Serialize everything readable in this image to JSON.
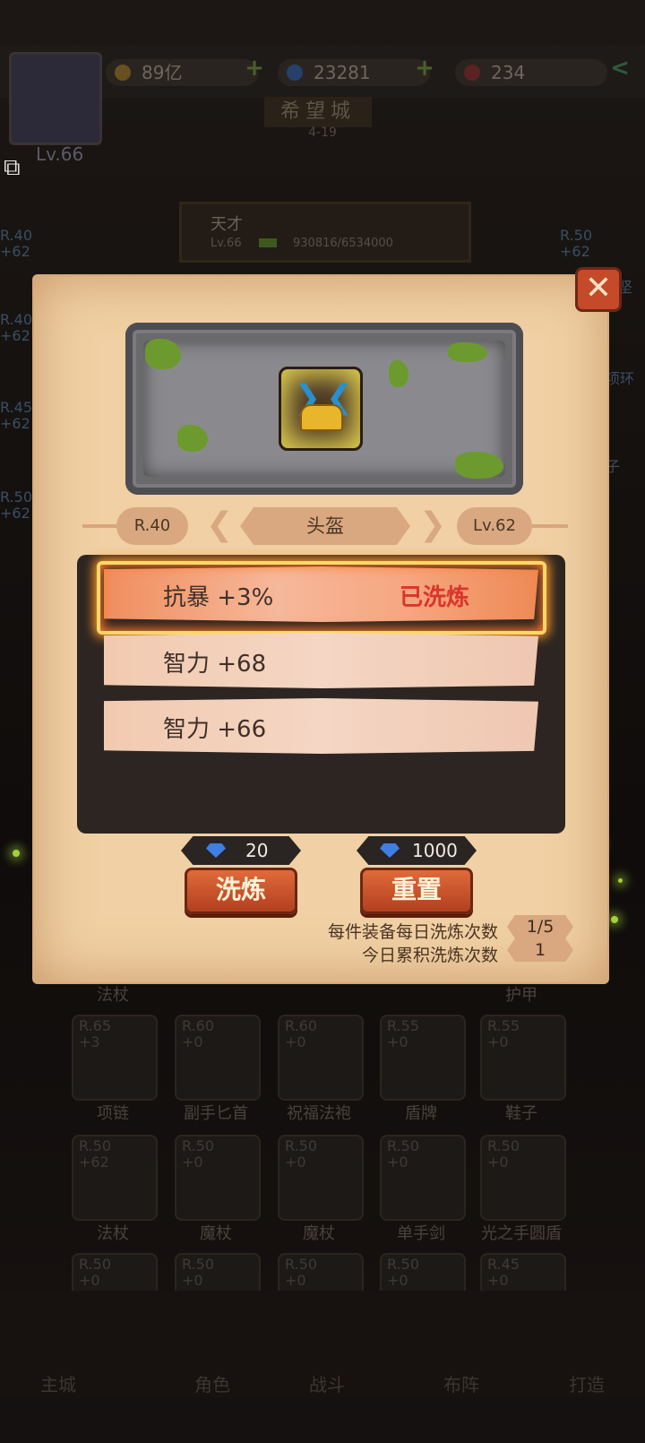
{
  "resources": {
    "gold": "89亿",
    "gems": "23281",
    "crystals": "234"
  },
  "player": {
    "level": "Lv.66",
    "name": "天才",
    "level_short": "Lv.66",
    "exp": "930816/6534000"
  },
  "city": {
    "name": "希望城",
    "sub": "4-19"
  },
  "bg_left": [
    "R.40\n+62",
    "R.40\n+62",
    "R.45\n+62",
    "R.50\n+62"
  ],
  "bg_right": [
    "R.50\n+62",
    "坚",
    "项环",
    "子"
  ],
  "bg_slots": [
    {
      "rank": "R.65",
      "plus": "+3",
      "label": "项链"
    },
    {
      "rank": "R.60",
      "plus": "+0",
      "label": "副手匕首"
    },
    {
      "rank": "R.60",
      "plus": "+0",
      "label": "祝福法袍"
    },
    {
      "rank": "R.55",
      "plus": "+0",
      "label": "盾牌"
    },
    {
      "rank": "R.55",
      "plus": "+0",
      "label": "鞋子"
    },
    {
      "rank": "R.50",
      "plus": "+62",
      "label": "法杖"
    },
    {
      "rank": "R.50",
      "plus": "+0",
      "label": "魔杖"
    },
    {
      "rank": "R.50",
      "plus": "+0",
      "label": "魔杖"
    },
    {
      "rank": "R.50",
      "plus": "+0",
      "label": "单手剑"
    },
    {
      "rank": "R.50",
      "plus": "+0",
      "label": "光之手圆盾"
    },
    {
      "rank": "R.50",
      "plus": "+0",
      "label": ""
    },
    {
      "rank": "R.50",
      "plus": "+0",
      "label": ""
    },
    {
      "rank": "R.50",
      "plus": "+0",
      "label": ""
    },
    {
      "rank": "R.50",
      "plus": "+0",
      "label": ""
    },
    {
      "rank": "R.45",
      "plus": "+0",
      "label": ""
    }
  ],
  "bg_headers": {
    "left": "法杖",
    "right": "护甲"
  },
  "nav": [
    "主城",
    "角色",
    "战斗",
    "布阵",
    "打造"
  ],
  "modal": {
    "close": "✕",
    "rank": "R.40",
    "item_name": "头盔",
    "item_level": "Lv.62",
    "stats": [
      {
        "text": "抗暴 +3%",
        "status": "已洗炼",
        "selected": true
      },
      {
        "text": "智力 +68",
        "status": "",
        "selected": false
      },
      {
        "text": "智力 +66",
        "status": "",
        "selected": false
      }
    ],
    "refine": {
      "cost": "20",
      "label": "洗炼"
    },
    "reset": {
      "cost": "1000",
      "label": "重置"
    },
    "counts": [
      {
        "label": "每件装备每日洗炼次数",
        "value": "1/5"
      },
      {
        "label": "今日累积洗炼次数",
        "value": "1"
      }
    ]
  },
  "colors": {
    "parchment": "#f0d0a4",
    "button": "#c44a2a",
    "washed_text": "#d8362d",
    "gem": "#3f7fe4"
  }
}
